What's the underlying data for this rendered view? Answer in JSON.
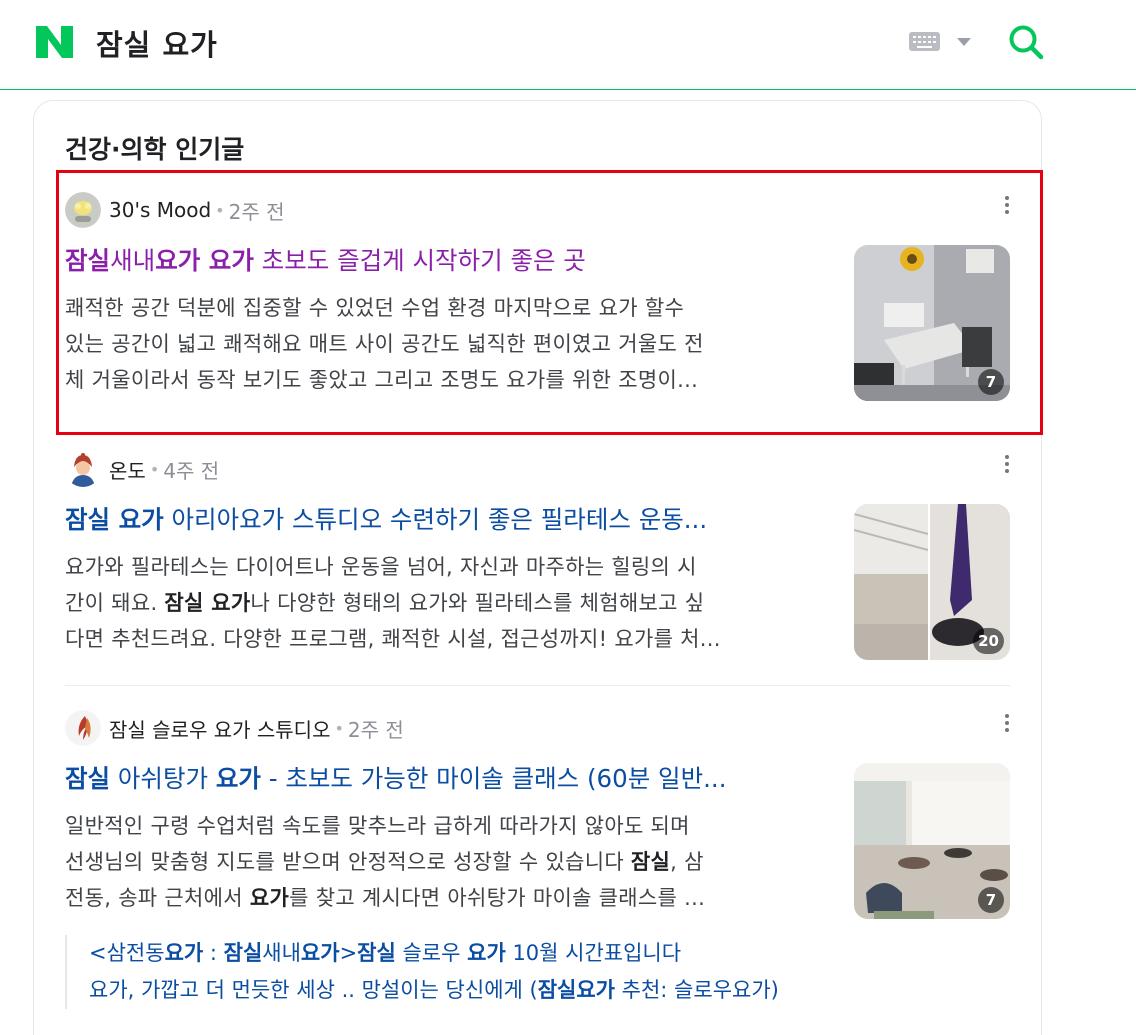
{
  "header": {
    "query": "잠실 요가",
    "logo_letter": "N",
    "brand_color": "#03c75a"
  },
  "section": {
    "title": "건강·의학 인기글"
  },
  "posts": [
    {
      "author": "30's Mood",
      "time": "2주 전",
      "title_parts": [
        {
          "t": "잠실",
          "b": true
        },
        {
          "t": "새내",
          "b": false
        },
        {
          "t": "요가 요가",
          "b": true
        },
        {
          "t": " 초보도 즐겁게 시작하기 좋은 곳",
          "b": false
        }
      ],
      "visited": true,
      "desc_lines": [
        [
          {
            "t": "쾌적한 공간 덕분에 집중할 수 있었던 수업 환경 마지막으로 요가 할수",
            "b": false
          }
        ],
        [
          {
            "t": "있는 공간이 넓고 쾌적해요 매트 사이 공간도 넓직한 편이였고 거울도 전",
            "b": false
          }
        ],
        [
          {
            "t": "체 거울이라서 동작 보기도 좋았고 그리고 조명도 요가를 위한 조명이...",
            "b": false
          }
        ]
      ],
      "image_count": "7"
    },
    {
      "author": "온도",
      "time": "4주 전",
      "title_parts": [
        {
          "t": "잠실 요가",
          "b": true
        },
        {
          "t": " 아리아요가 스튜디오 수련하기 좋은 필라테스 운동...",
          "b": false
        }
      ],
      "visited": false,
      "desc_lines": [
        [
          {
            "t": "요가와 필라테스는 다이어트나 운동을 넘어, 자신과 마주하는 힐링의 시",
            "b": false
          }
        ],
        [
          {
            "t": "간이 돼요. ",
            "b": false
          },
          {
            "t": "잠실 요가",
            "b": true
          },
          {
            "t": "나 다양한 형태의 요가와 필라테스를 체험해보고 싶",
            "b": false
          }
        ],
        [
          {
            "t": "다면 추천드려요. 다양한 프로그램, 쾌적한 시설, 접근성까지! 요가를 처...",
            "b": false
          }
        ]
      ],
      "image_count": "20"
    },
    {
      "author": "잠실 슬로우 요가 스튜디오",
      "time": "2주 전",
      "title_parts": [
        {
          "t": "잠실",
          "b": true
        },
        {
          "t": " 아쉬탕가 ",
          "b": false
        },
        {
          "t": "요가",
          "b": true
        },
        {
          "t": " - 초보도 가능한 마이솔 클래스 (60분 일반...",
          "b": false
        }
      ],
      "visited": false,
      "desc_lines": [
        [
          {
            "t": "일반적인 구령 수업처럼 속도를 맞추느라 급하게 따라가지 않아도 되며",
            "b": false
          }
        ],
        [
          {
            "t": "선생님의 맞춤형 지도를 받으며 안정적으로 성장할 수 있습니다 ",
            "b": false
          },
          {
            "t": "잠실",
            "b": true
          },
          {
            "t": ", 삼",
            "b": false
          }
        ],
        [
          {
            "t": "전동, 송파 근처에서 ",
            "b": false
          },
          {
            "t": "요가",
            "b": true
          },
          {
            "t": "를 찾고 계시다면 아쉬탕가 마이솔 클래스를 ...",
            "b": false
          }
        ]
      ],
      "image_count": "7"
    }
  ],
  "related_links": [
    [
      {
        "t": "<삼전동",
        "b": false
      },
      {
        "t": "요가",
        "b": true
      },
      {
        "t": " : ",
        "b": false
      },
      {
        "t": "잠실",
        "b": true
      },
      {
        "t": "새내",
        "b": false
      },
      {
        "t": "요가",
        "b": true
      },
      {
        "t": ">",
        "b": false
      },
      {
        "t": "잠실",
        "b": true
      },
      {
        "t": " 슬로우 ",
        "b": false
      },
      {
        "t": "요가",
        "b": true
      },
      {
        "t": " 10월 시간표입니다",
        "b": false
      }
    ],
    [
      {
        "t": "요가, 가깝고 더 먼듯한 세상 .. 망설이는 당신에게 (",
        "b": false
      },
      {
        "t": "잠실요가",
        "b": true
      },
      {
        "t": " 추천: 슬로우요가)",
        "b": false
      }
    ]
  ],
  "colors": {
    "link": "#0b4da2",
    "visited": "#8b1fa9",
    "highlight_border": "#e60012"
  }
}
